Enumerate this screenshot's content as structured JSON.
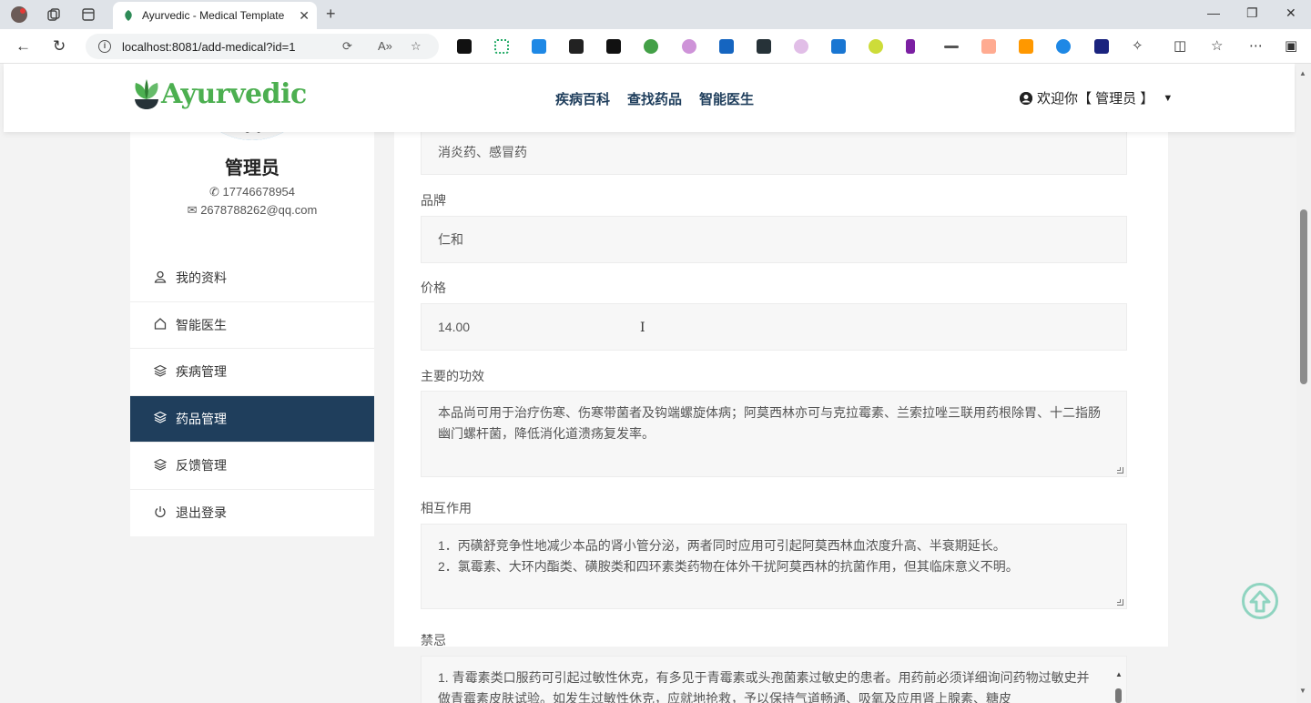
{
  "browser": {
    "tab_title": "Ayurvedic - Medical Template",
    "url": "localhost:8081/add-medical?id=1"
  },
  "header": {
    "logo_text": "Ayurvedic",
    "nav": [
      "疾病百科",
      "查找药品",
      "智能医生"
    ],
    "user_greeting": "欢迎你【 管理员 】"
  },
  "profile": {
    "name": "管理员",
    "phone": "17746678954",
    "email": "2678788262@qq.com"
  },
  "menu": [
    {
      "label": "我的资料",
      "icon": "user-icon"
    },
    {
      "label": "智能医生",
      "icon": "home-icon"
    },
    {
      "label": "疾病管理",
      "icon": "layers-icon"
    },
    {
      "label": "药品管理",
      "icon": "layers-icon"
    },
    {
      "label": "反馈管理",
      "icon": "layers-icon"
    },
    {
      "label": "退出登录",
      "icon": "power-icon"
    }
  ],
  "form": {
    "category_value": "消炎药、感冒药",
    "brand_label": "品牌",
    "brand_value": "仁和",
    "price_label": "价格",
    "price_value": "14.00",
    "effect_label": "主要的功效",
    "effect_value": "本品尚可用于治疗伤寒、伤寒带菌者及钩端螺旋体病；阿莫西林亦可与克拉霉素、兰索拉唑三联用药根除胃、十二指肠幽门螺杆菌，降低消化道溃疡复发率。",
    "interaction_label": "相互作用",
    "interaction_line1": "1．丙磺舒竞争性地减少本品的肾小管分泌，两者同时应用可引起阿莫西林血浓度升高、半衰期延长。",
    "interaction_line2": "2．氯霉素、大环内酯类、磺胺类和四环素类药物在体外干扰阿莫西林的抗菌作用，但其临床意义不明。",
    "taboo_label": "禁忌",
    "taboo_value": "1. 青霉素类口服药可引起过敏性休克，有多见于青霉素或头孢菌素过敏史的患者。用药前必须详细询问药物过敏史并做青霉素皮肤试验。如发生过敏性休克，应就地抢救，予以保持气道畅通、吸氧及应用肾上腺素、糖皮"
  },
  "colors": {
    "brand_green": "#4caf50",
    "nav_navy": "#1f3e5c",
    "active_menu_bg": "#1f3e5c"
  }
}
